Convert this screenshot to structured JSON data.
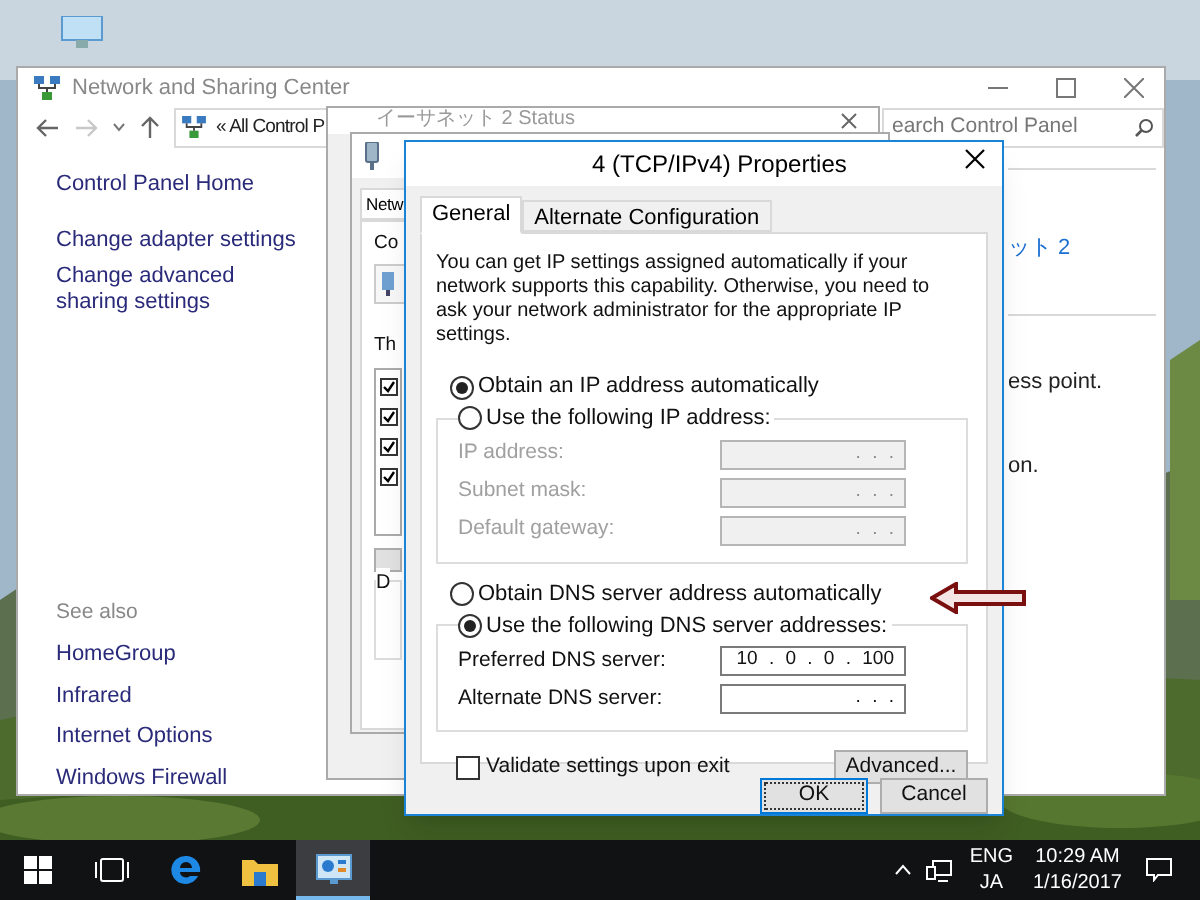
{
  "network_center": {
    "title": "Network and Sharing Center",
    "address": "« All Control P",
    "search_placeholder": "earch Control Panel",
    "sidebar": {
      "home": "Control Panel Home",
      "links": [
        "Change adapter settings",
        "Change advanced sharing settings"
      ],
      "see_also_title": "See also",
      "see_also": [
        "HomeGroup",
        "Infrared",
        "Internet Options",
        "Windows Firewall"
      ]
    },
    "connection_link": "ット 2",
    "text_fragments": [
      "ess point.",
      "on."
    ]
  },
  "status_window": {
    "title": "イーサネット 2 Status"
  },
  "adapter_window": {
    "tab": "Netw",
    "connect_label": "Co",
    "items_label": "Th",
    "group_label": "D",
    "items": [
      {
        "checked": true
      },
      {
        "checked": true
      },
      {
        "checked": true
      },
      {
        "checked": true
      }
    ]
  },
  "ipv4_dialog": {
    "title": "4 (TCP/IPv4) Properties",
    "tabs": [
      {
        "label": "General",
        "selected": true
      },
      {
        "label": "Alternate Configuration",
        "selected": false
      }
    ],
    "description": "You can get IP settings assigned automatically if your network supports this capability. Otherwise, you need to ask your network administrator for the appropriate IP settings.",
    "ip_options": [
      {
        "label": "Obtain an IP address automatically",
        "selected": true
      },
      {
        "label": "Use the following IP address:",
        "selected": false
      }
    ],
    "ip_fields": [
      {
        "label": "IP address:",
        "value": ". . .",
        "disabled": true
      },
      {
        "label": "Subnet mask:",
        "value": ". . .",
        "disabled": true
      },
      {
        "label": "Default gateway:",
        "value": ". . .",
        "disabled": true
      }
    ],
    "dns_options": [
      {
        "label": "Obtain DNS server address automatically",
        "selected": false
      },
      {
        "label": "Use the following DNS server addresses:",
        "selected": true
      }
    ],
    "dns_fields": [
      {
        "label": "Preferred DNS server:",
        "value": "10 . 0 . 0 . 100",
        "disabled": false
      },
      {
        "label": "Alternate DNS server:",
        "value": ". . .",
        "disabled": false
      }
    ],
    "validate": {
      "label": "Validate settings upon exit",
      "checked": false
    },
    "advanced_button": "Advanced...",
    "buttons": [
      {
        "label": "OK",
        "default": true
      },
      {
        "label": "Cancel",
        "default": false
      }
    ]
  },
  "taskbar": {
    "apps": [
      {
        "kind": "start",
        "selected": false
      },
      {
        "kind": "taskview",
        "selected": false
      },
      {
        "kind": "edge",
        "selected": false
      },
      {
        "kind": "explorer",
        "selected": false
      },
      {
        "kind": "controlpanel",
        "selected": true
      }
    ],
    "language": "ENG",
    "ime": "JA",
    "time": "10:29 AM",
    "date": "1/16/2017"
  }
}
